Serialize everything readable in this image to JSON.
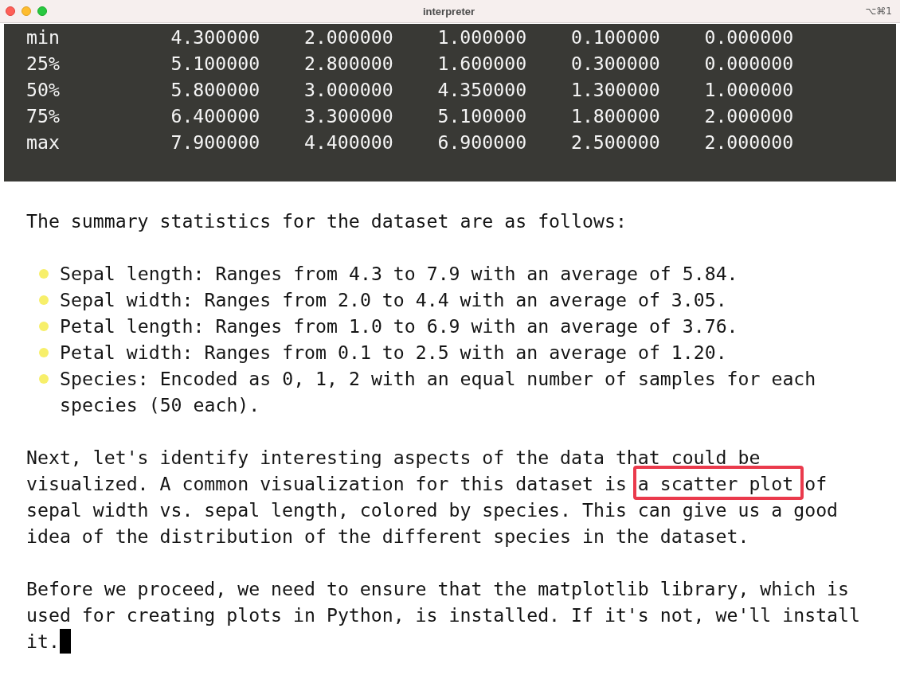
{
  "window": {
    "title": "interpreter",
    "shortcut": "⌥⌘1"
  },
  "output": {
    "rows": [
      {
        "label": "min",
        "values": [
          "4.300000",
          "2.000000",
          "1.000000",
          "0.100000",
          "0.000000"
        ]
      },
      {
        "label": "25%",
        "values": [
          "5.100000",
          "2.800000",
          "1.600000",
          "0.300000",
          "0.000000"
        ]
      },
      {
        "label": "50%",
        "values": [
          "5.800000",
          "3.000000",
          "4.350000",
          "1.300000",
          "1.000000"
        ]
      },
      {
        "label": "75%",
        "values": [
          "6.400000",
          "3.300000",
          "5.100000",
          "1.800000",
          "2.000000"
        ]
      },
      {
        "label": "max",
        "values": [
          "7.900000",
          "4.400000",
          "6.900000",
          "2.500000",
          "2.000000"
        ]
      }
    ]
  },
  "message": {
    "blocks": [
      {
        "kind": "paragraph",
        "cursor": false,
        "segments": [
          {
            "text": "The summary statistics for the dataset are as follows:",
            "highlighted": false
          }
        ]
      },
      {
        "kind": "bullets",
        "items": [
          "Sepal length: Ranges from 4.3 to 7.9 with an average of 5.84.",
          "Sepal width: Ranges from 2.0 to 4.4 with an average of 3.05.",
          "Petal length: Ranges from 1.0 to 6.9 with an average of 3.76.",
          "Petal width: Ranges from 0.1 to 2.5 with an average of 1.20.",
          "Species: Encoded as 0, 1, 2 with an equal number of samples for each species (50 each)."
        ]
      },
      {
        "kind": "paragraph",
        "cursor": false,
        "segments": [
          {
            "text": "Next, let's identify interesting aspects of the data that could be visualized. A common visualization for this dataset is ",
            "highlighted": false
          },
          {
            "text": "a scatter plot",
            "highlighted": true
          },
          {
            "text": " of sepal width vs. sepal length, colored by species. This can give us a good idea of the distribution of the different species in the dataset.",
            "highlighted": false
          }
        ]
      },
      {
        "kind": "paragraph",
        "cursor": true,
        "segments": [
          {
            "text": "Before we proceed, we need to ensure that the matplotlib library, which is used for creating plots in Python, is installed. If it's not, we'll install it.",
            "highlighted": false
          }
        ]
      }
    ]
  }
}
